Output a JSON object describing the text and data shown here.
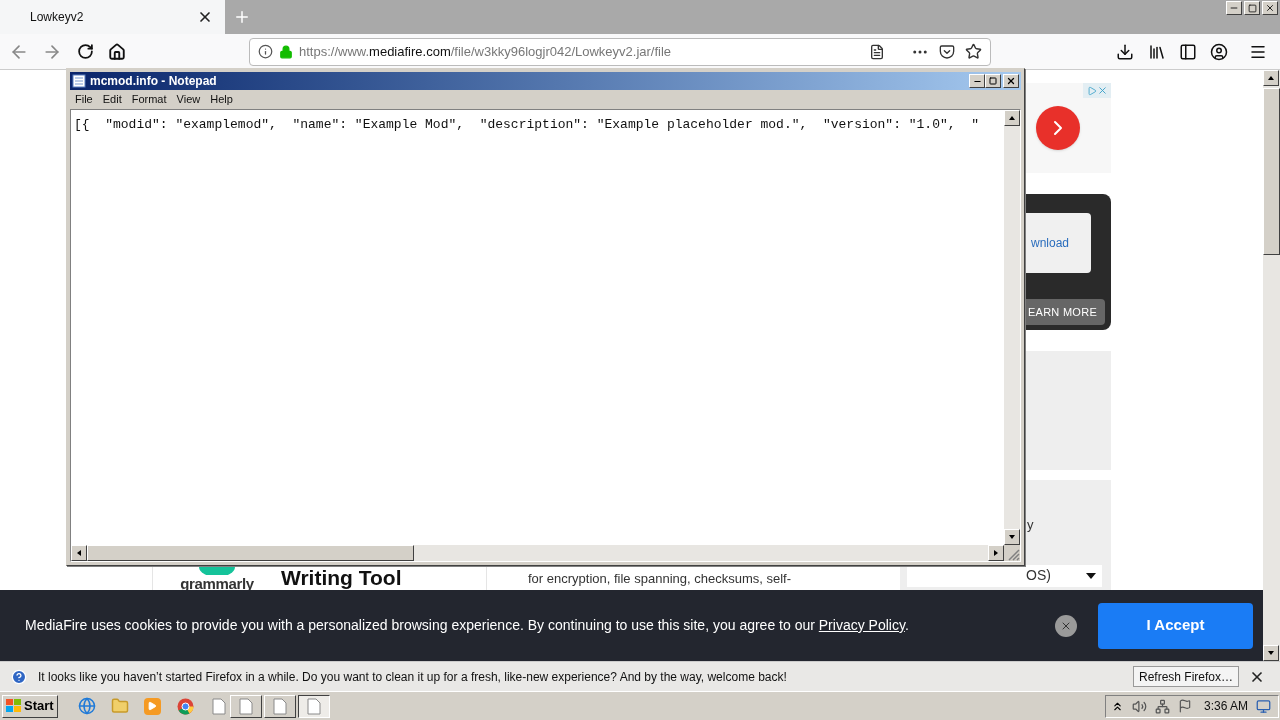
{
  "browser": {
    "tab": {
      "title": "Lowkeyv2"
    },
    "url": {
      "prefix": "https://www.",
      "domain": "mediafire.com",
      "path": "/file/w3kky96logjr042/Lowkeyv2.jar/file"
    }
  },
  "page": {
    "ad_card": {
      "link": "wnload",
      "button": "EARN MORE"
    },
    "os_panel": {
      "label": "y",
      "select": "OS)"
    },
    "article": {
      "logo": "grammarly",
      "title": "Writing Tool",
      "text": "for encryption, file spanning, checksums, self-"
    },
    "cookie_banner": {
      "text": "MediaFire uses cookies to provide you with a personalized browsing experience. By continuing to use this site, you agree to our ",
      "link": "Privacy Policy",
      "end": ".",
      "button": "I Accept"
    }
  },
  "notepad": {
    "title": "mcmod.info - Notepad",
    "menu": [
      "File",
      "Edit",
      "Format",
      "View",
      "Help"
    ],
    "content": "[{  \"modid\": \"examplemod\",  \"name\": \"Example Mod\",  \"description\": \"Example placeholder mod.\",  \"version\": \"1.0\",  \""
  },
  "notification": {
    "text": "It looks like you haven’t started Firefox in a while. Do you want to clean it up for a fresh, like-new experience? And by the way, welcome back!",
    "button": "Refresh Firefox…"
  },
  "taskbar": {
    "start": "Start",
    "windows": [
      {
        "selected": false
      },
      {
        "selected": false
      },
      {
        "selected": true
      }
    ],
    "clock": "3:36 AM"
  }
}
